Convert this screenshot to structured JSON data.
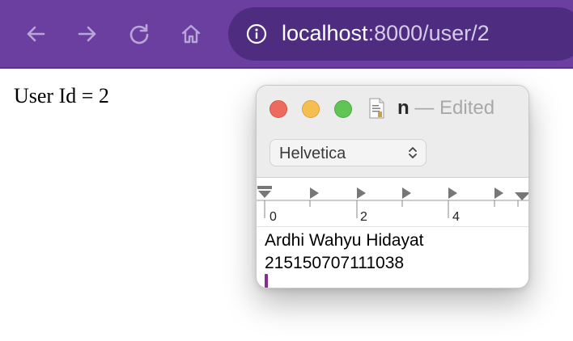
{
  "browser": {
    "url_host": "localhost",
    "url_rest": ":8000/user/2",
    "icons": {
      "back": "arrow-left-icon",
      "forward": "arrow-right-icon",
      "reload": "reload-icon",
      "home": "home-icon",
      "info": "info-icon"
    },
    "toolbar_color": "#6a3fa0",
    "address_bar_color": "#4e2c80"
  },
  "page": {
    "text": "User Id = 2"
  },
  "textedit": {
    "title_name": "n",
    "title_separator": "—",
    "title_status": "Edited",
    "font": "Helvetica",
    "ruler_labels": [
      "0",
      "2",
      "4"
    ],
    "content": {
      "line1": "Ardhi Wahyu Hidayat",
      "line2": "215150707111038"
    },
    "traffic_lights": {
      "close": "#ed6a5e",
      "minimize": "#f5bf4f",
      "zoom": "#61c554"
    },
    "cursor_color": "#8a2c8f"
  }
}
